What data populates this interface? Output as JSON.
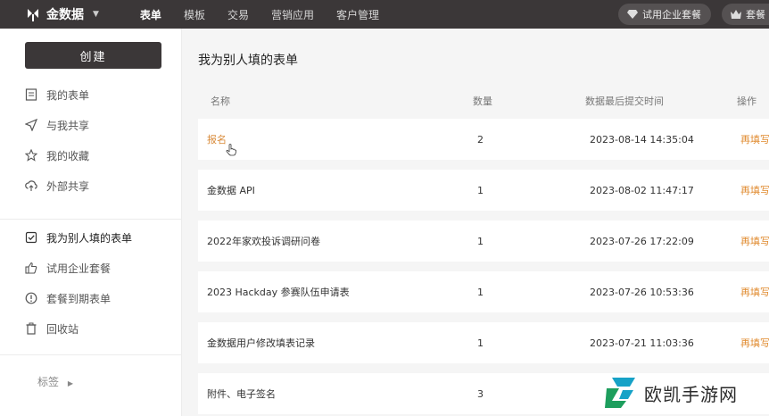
{
  "app": {
    "name": "金数据"
  },
  "nav": {
    "items": [
      {
        "label": "表单",
        "active": true
      },
      {
        "label": "模板",
        "active": false
      },
      {
        "label": "交易",
        "active": false
      },
      {
        "label": "营销应用",
        "active": false
      },
      {
        "label": "客户管理",
        "active": false
      }
    ],
    "trial_label": "试用企业套餐",
    "plan_label": "套餐"
  },
  "sidebar": {
    "create_label": "创建",
    "items": [
      {
        "label": "我的表单",
        "icon": "document-icon"
      },
      {
        "label": "与我共享",
        "icon": "send-icon"
      },
      {
        "label": "我的收藏",
        "icon": "star-icon"
      },
      {
        "label": "外部共享",
        "icon": "cloud-share-icon"
      },
      {
        "label": "我为别人填的表单",
        "icon": "checkbox-icon",
        "active": true
      },
      {
        "label": "试用企业套餐",
        "icon": "thumbs-up-icon"
      },
      {
        "label": "套餐到期表单",
        "icon": "alert-icon"
      },
      {
        "label": "回收站",
        "icon": "trash-icon"
      }
    ],
    "tag_label": "标签"
  },
  "main": {
    "title": "我为别人填的表单",
    "columns": {
      "name": "名称",
      "count": "数量",
      "time": "数据最后提交时间",
      "action": "操作"
    },
    "rows": [
      {
        "name": "报名",
        "count": "2",
        "time": "2023-08-14 14:35:04",
        "action": "再填写"
      },
      {
        "name": "金数据 API",
        "count": "1",
        "time": "2023-08-02 11:47:17",
        "action": "再填写"
      },
      {
        "name": "2022年家欢投诉调研问卷",
        "count": "1",
        "time": "2023-07-26 17:22:09",
        "action": "再填写"
      },
      {
        "name": "2023 Hackday 参赛队伍申请表",
        "count": "1",
        "time": "2023-07-26 10:53:36",
        "action": "再填写"
      },
      {
        "name": "金数据用户修改填表记录",
        "count": "1",
        "time": "2023-07-21 11:03:36",
        "action": "再填写"
      },
      {
        "name": "附件、电子签名",
        "count": "3",
        "time": "",
        "action": ""
      }
    ]
  },
  "watermark": {
    "text": "欧凯手游网"
  },
  "colors": {
    "topbar": "#3b3738",
    "accent": "#e08a2e",
    "link": "#d98b3a"
  }
}
